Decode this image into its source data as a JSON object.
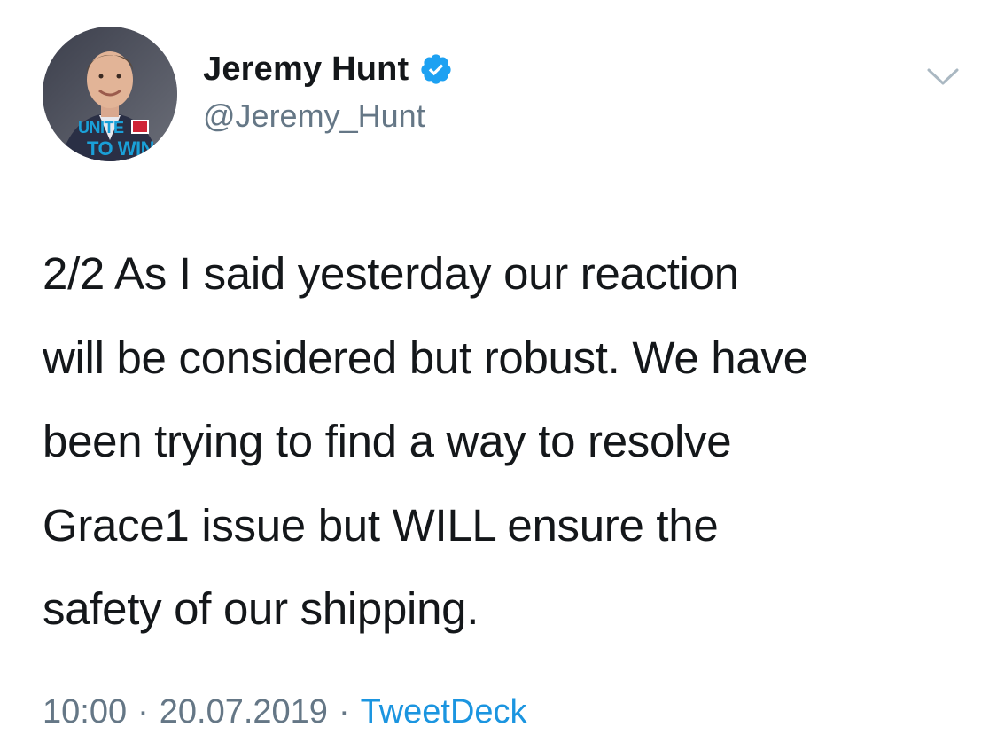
{
  "author": {
    "display_name": "Jeremy Hunt",
    "handle": "@Jeremy_Hunt",
    "verified": true,
    "avatar_badge_line1": "UNITE",
    "avatar_badge_line2": "TO WIN"
  },
  "tweet": {
    "text": "2/2 As I said yesterday our reaction\nwill be considered but robust. We have\nbeen trying to  find a way to resolve\nGrace1 issue but WILL ensure the\nsafety of our shipping."
  },
  "meta": {
    "time": "10:00",
    "date": "20.07.2019",
    "separator": "·",
    "source": "TweetDeck"
  },
  "colors": {
    "text": "#14171a",
    "secondary": "#657786",
    "accent": "#1b95e0",
    "verified_badge": "#1da1f2"
  },
  "icons": {
    "verified": "verified-badge-icon",
    "menu": "chevron-down-icon"
  }
}
